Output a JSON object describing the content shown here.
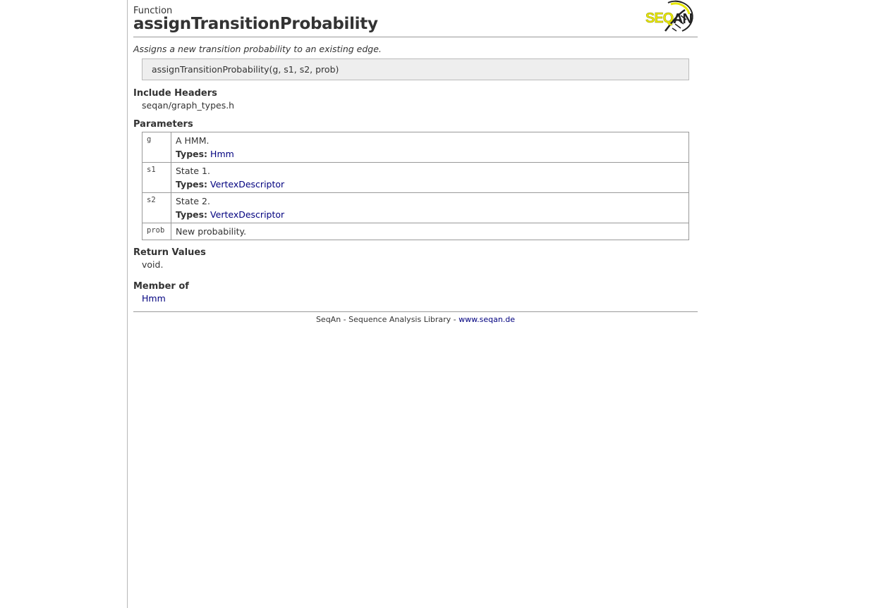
{
  "header": {
    "kind": "Function",
    "title": "assignTransitionProbability",
    "logo_text": "SEQAN"
  },
  "summary": "Assigns a new transition probability to an existing edge.",
  "signature": "assignTransitionProbability(g, s1, s2, prob)",
  "include_headers": {
    "title": "Include Headers",
    "value": "seqan/graph_types.h"
  },
  "parameters": {
    "title": "Parameters",
    "types_label": "Types:",
    "rows": [
      {
        "name": "g",
        "desc": "A HMM.",
        "type": "Hmm"
      },
      {
        "name": "s1",
        "desc": "State 1.",
        "type": "VertexDescriptor"
      },
      {
        "name": "s2",
        "desc": "State 2.",
        "type": "VertexDescriptor"
      },
      {
        "name": "prob",
        "desc": "New probability."
      }
    ]
  },
  "return_values": {
    "title": "Return Values",
    "value": "void."
  },
  "member_of": {
    "title": "Member of",
    "value": "Hmm"
  },
  "footer": {
    "text": "SeqAn - Sequence Analysis Library - ",
    "link": "www.seqan.de"
  },
  "colors": {
    "link": "#00007f",
    "logo_yellow": "#e6e600",
    "signature_bg": "#eeeeee"
  }
}
